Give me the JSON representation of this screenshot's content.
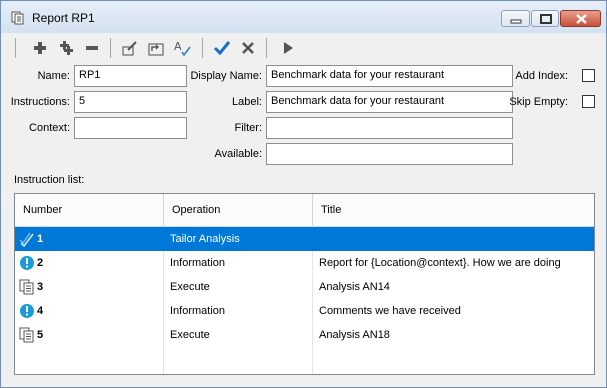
{
  "window": {
    "title": "Report RP1",
    "icon": "report-icon"
  },
  "toolbar": {
    "buttons": [
      {
        "name": "add",
        "icon": "plus-icon"
      },
      {
        "name": "add-child",
        "icon": "plus-plus-icon"
      },
      {
        "name": "remove",
        "icon": "minus-icon"
      },
      {
        "name": "edit",
        "icon": "edit-icon"
      },
      {
        "name": "parent",
        "icon": "parent-icon"
      },
      {
        "name": "spell",
        "icon": "spellcheck-icon"
      },
      {
        "name": "ok",
        "icon": "checkmark-icon"
      },
      {
        "name": "cancel",
        "icon": "x-icon"
      },
      {
        "name": "run",
        "icon": "play-icon"
      }
    ]
  },
  "form": {
    "name_label": "Name:",
    "name_value": "RP1",
    "instructions_label": "Instructions:",
    "instructions_value": "5",
    "context_label": "Context:",
    "context_value": "",
    "display_name_label": "Display Name:",
    "display_name_value": "Benchmark data for your restaurant",
    "label_label": "Label:",
    "label_value": "Benchmark data for your restaurant",
    "filter_label": "Filter:",
    "filter_value": "",
    "available_label": "Available:",
    "available_value": "",
    "add_index_label": "Add Index:",
    "skip_empty_label": "Skip Empty:"
  },
  "instruction_list": {
    "caption": "Instruction list:",
    "columns": [
      "Number",
      "Operation",
      "Title"
    ],
    "rows": [
      {
        "number": "1",
        "operation": "Tailor Analysis",
        "title": "",
        "icon": "tailor-icon",
        "selected": true
      },
      {
        "number": "2",
        "operation": "Information",
        "title": "Report for {Location@context}. How we are doing",
        "icon": "info-icon",
        "selected": false
      },
      {
        "number": "3",
        "operation": "Execute",
        "title": "Analysis AN14",
        "icon": "execute-icon",
        "selected": false
      },
      {
        "number": "4",
        "operation": "Information",
        "title": "Comments we have received",
        "icon": "info-icon",
        "selected": false
      },
      {
        "number": "5",
        "operation": "Execute",
        "title": "Analysis AN18",
        "icon": "execute-icon",
        "selected": false
      }
    ]
  },
  "colors": {
    "selection": "#0078d7",
    "info": "#1a9bd7",
    "accent": "#1a6fc9"
  }
}
